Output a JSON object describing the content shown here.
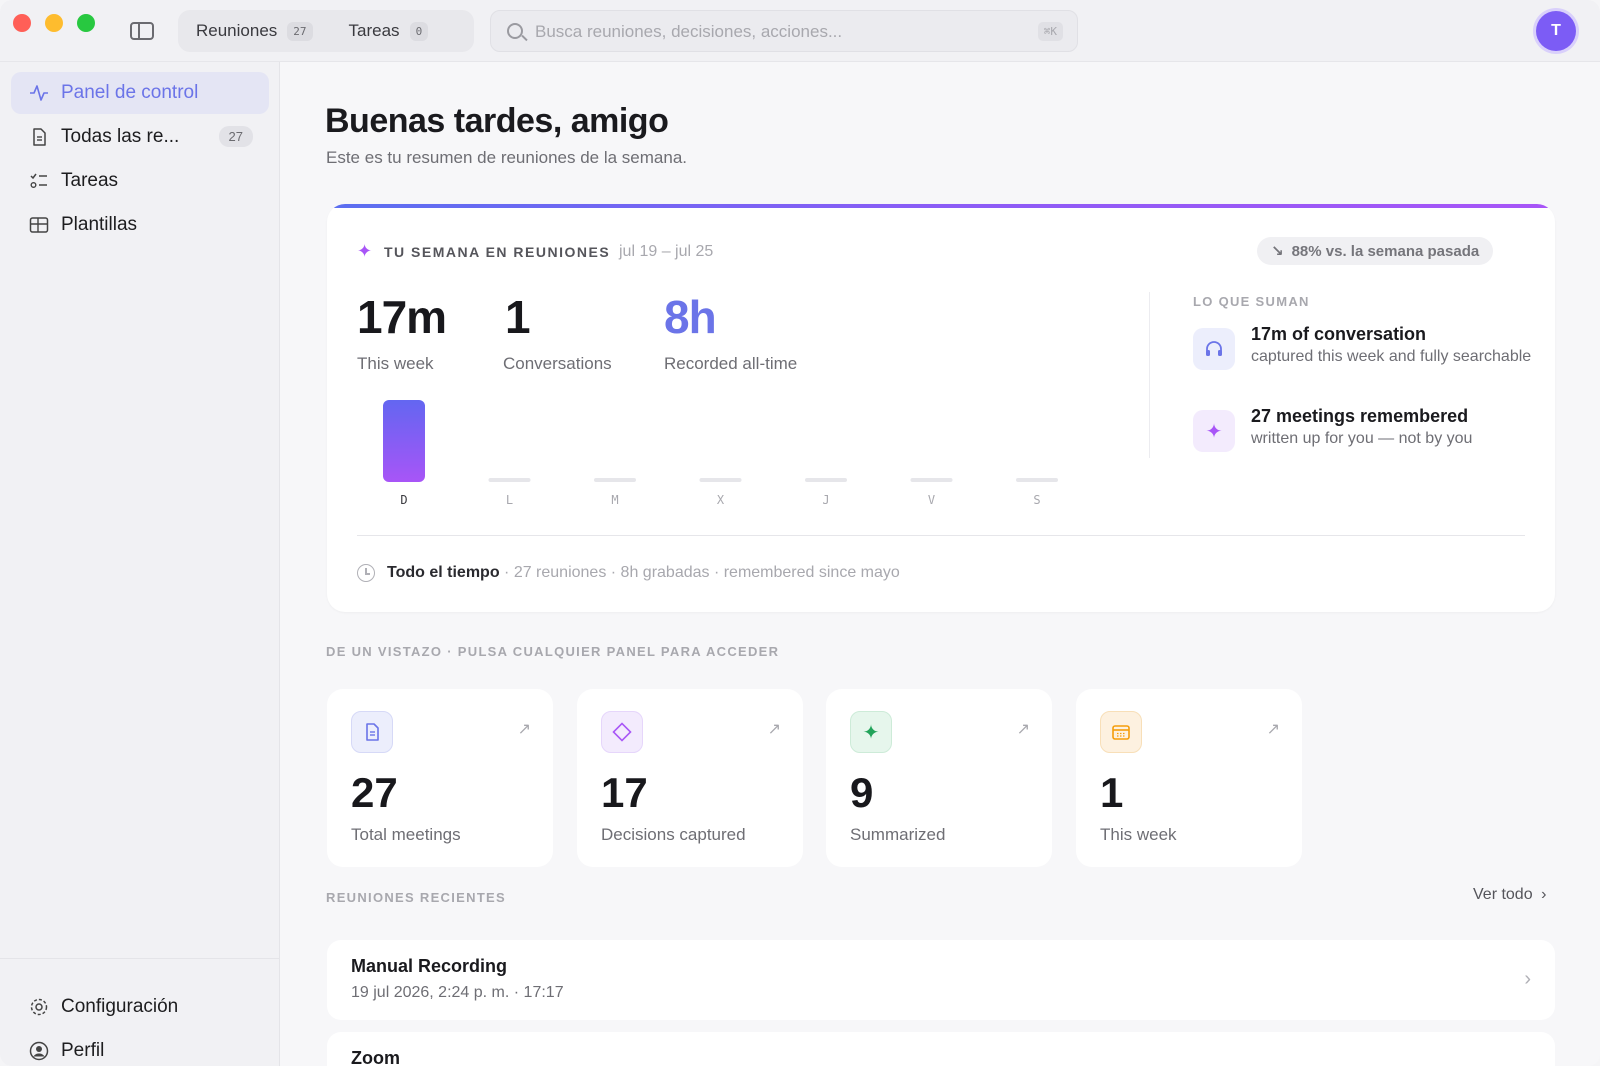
{
  "topbar": {
    "tabs": [
      {
        "label": "Reuniones",
        "count": "27"
      },
      {
        "label": "Tareas",
        "count": "0"
      }
    ],
    "search_placeholder": "Busca reuniones, decisiones, acciones...",
    "shortcut": "⌘K",
    "avatar_initial": "T"
  },
  "sidebar": {
    "items": [
      {
        "label": "Panel de control",
        "icon": "activity-icon",
        "active": true
      },
      {
        "label": "Todas las re...",
        "icon": "document-icon",
        "count": "27"
      },
      {
        "label": "Tareas",
        "icon": "checklist-icon"
      },
      {
        "label": "Plantillas",
        "icon": "table-icon"
      }
    ],
    "bottom": [
      {
        "label": "Configuración",
        "icon": "gear-icon"
      },
      {
        "label": "Perfil",
        "icon": "profile-icon"
      }
    ]
  },
  "main": {
    "greeting": "Buenas tardes, amigo",
    "subtitle": "Este es tu resumen de reuniones de la semana.",
    "week": {
      "title": "TU SEMANA EN REUNIONES",
      "range": "jul 19 – jul 25",
      "trend": "88% vs. la semana pasada",
      "trend_arrow": "↘",
      "stats": [
        {
          "value": "17m",
          "label": "This week"
        },
        {
          "value": "1",
          "label": "Conversations"
        },
        {
          "value": "8h",
          "label": "Recorded all-time"
        }
      ],
      "summary_title": "LO QUE SUMAN",
      "summary_items": [
        {
          "head": "17m of conversation",
          "sub": "captured this week and fully searchable",
          "icon": "headphones-icon"
        },
        {
          "head": "27 meetings remembered",
          "sub": "written up for you — not by you",
          "icon": "sparkle-icon"
        }
      ],
      "footer_strong": "Todo el tiempo",
      "footer_rest": " · 27 reuniones · 8h grabadas · remembered since mayo"
    },
    "glance_title": "DE UN VISTAZO · PULSA CUALQUIER PANEL PARA ACCEDER",
    "tiles": [
      {
        "value": "27",
        "label": "Total meetings",
        "icon": "document-icon",
        "color": "#6b74e8",
        "bg": "#eceefc"
      },
      {
        "value": "17",
        "label": "Decisions captured",
        "icon": "diamond-icon",
        "color": "#a855f7",
        "bg": "#f3ebfd"
      },
      {
        "value": "9",
        "label": "Summarized",
        "icon": "sparkle-icon",
        "color": "#22a35a",
        "bg": "#e6f6ec"
      },
      {
        "value": "1",
        "label": "This week",
        "icon": "calendar-icon",
        "color": "#f59e0b",
        "bg": "#fdf1e0"
      }
    ],
    "recent_title": "REUNIONES RECIENTES",
    "see_all": "Ver todo",
    "recent": [
      {
        "title": "Manual Recording",
        "meta": "19 jul 2026, 2:24 p. m. · 17:17"
      },
      {
        "title": "Zoom",
        "meta": ""
      }
    ]
  },
  "chart_data": {
    "type": "bar",
    "categories": [
      "D",
      "L",
      "M",
      "X",
      "J",
      "V",
      "S"
    ],
    "values": [
      17,
      0,
      0,
      0,
      0,
      0,
      0
    ],
    "colors": {
      "bar_top": "#6366f1",
      "bar_bottom": "#a855f7",
      "empty": "#e6e6ea"
    }
  }
}
